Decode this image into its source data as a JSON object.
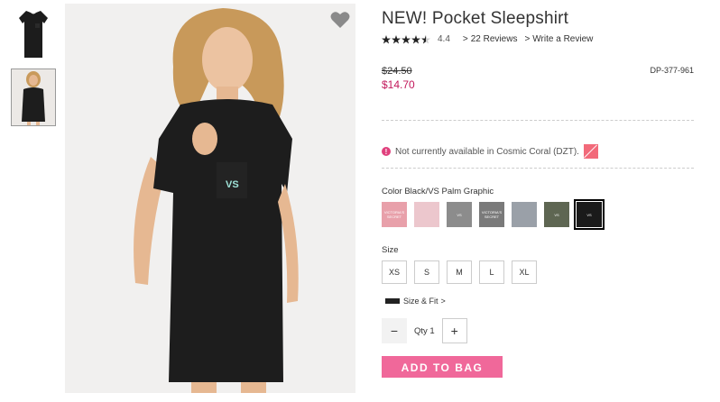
{
  "product": {
    "title": "NEW! Pocket Sleepshirt",
    "rating_value": "4.4",
    "rating_stars": 4.5,
    "reviews_link": "22 Reviews",
    "write_review_link": "Write a Review",
    "price_old": "$24.50",
    "price_new": "$14.70",
    "sku": "DP-377-961",
    "availability_message": "Not currently available in Cosmic Coral (DZT).",
    "color_label": "Color Black/VS Palm Graphic",
    "colors": [
      {
        "name": "pink-vs-logo",
        "bg": "#e8a0aa",
        "text": "VICTORIA'S SECRET"
      },
      {
        "name": "light-pink",
        "bg": "#ecc7cd",
        "text": ""
      },
      {
        "name": "gray-palm",
        "bg": "#8c8c8c",
        "text": "VS"
      },
      {
        "name": "charcoal-logo",
        "bg": "#7a7a7a",
        "text": "VICTORIA'S SECRET"
      },
      {
        "name": "heather-gray",
        "bg": "#9aa0a8",
        "text": ""
      },
      {
        "name": "olive-palm",
        "bg": "#5e6652",
        "text": "VS"
      },
      {
        "name": "black-palm",
        "bg": "#1a1a1a",
        "text": "VS"
      }
    ],
    "selected_color_index": 6,
    "size_label": "Size",
    "sizes": [
      "XS",
      "S",
      "M",
      "L",
      "XL"
    ],
    "size_fit_link": "Size & Fit",
    "qty_label": "Qty",
    "qty_value": "1",
    "add_to_bag": "ADD TO BAG"
  },
  "colors": {
    "accent_pink": "#f0689a",
    "sale_price": "#c2185b"
  }
}
